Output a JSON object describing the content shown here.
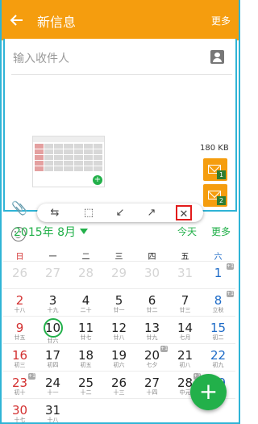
{
  "appbar": {
    "title": "新信息",
    "more": "更多"
  },
  "compose": {
    "recipient_placeholder": "输入收件人",
    "attachment_size": "180 KB",
    "msg_badges": [
      "1",
      "2"
    ]
  },
  "toolbar": {
    "tools": [
      "rotate",
      "crop",
      "shrink",
      "expand",
      "close"
    ]
  },
  "calendar": {
    "month_title": "2015年 8月",
    "today_label": "今天",
    "more_label": "更多",
    "weekdays": [
      "日",
      "一",
      "二",
      "三",
      "四",
      "五",
      "六"
    ],
    "weeks": [
      [
        {
          "d": "26",
          "l": "",
          "f": true
        },
        {
          "d": "27",
          "l": "",
          "f": true
        },
        {
          "d": "28",
          "l": "",
          "f": true
        },
        {
          "d": "29",
          "l": "",
          "f": true
        },
        {
          "d": "30",
          "l": "",
          "f": true
        },
        {
          "d": "31",
          "l": "",
          "f": true
        },
        {
          "d": "1",
          "l": "",
          "f": false,
          "b": true
        }
      ],
      [
        {
          "d": "2",
          "l": "十八"
        },
        {
          "d": "3",
          "l": "十九"
        },
        {
          "d": "4",
          "l": "二十"
        },
        {
          "d": "5",
          "l": "廿一"
        },
        {
          "d": "6",
          "l": "廿二"
        },
        {
          "d": "7",
          "l": "廿三"
        },
        {
          "d": "8",
          "l": "立秋",
          "b": true
        }
      ],
      [
        {
          "d": "9",
          "l": "廿五"
        },
        {
          "d": "10",
          "l": "廿六",
          "today": true
        },
        {
          "d": "11",
          "l": "廿七"
        },
        {
          "d": "12",
          "l": "廿八"
        },
        {
          "d": "13",
          "l": "廿九"
        },
        {
          "d": "14",
          "l": "七月"
        },
        {
          "d": "15",
          "l": "初二"
        }
      ],
      [
        {
          "d": "16",
          "l": "初三"
        },
        {
          "d": "17",
          "l": "初四"
        },
        {
          "d": "18",
          "l": "初五"
        },
        {
          "d": "19",
          "l": "初六"
        },
        {
          "d": "20",
          "l": "七夕",
          "b": true
        },
        {
          "d": "21",
          "l": "初八"
        },
        {
          "d": "22",
          "l": "初九"
        }
      ],
      [
        {
          "d": "23",
          "l": "初十",
          "b": true
        },
        {
          "d": "24",
          "l": "十一"
        },
        {
          "d": "25",
          "l": "十二"
        },
        {
          "d": "26",
          "l": "十三"
        },
        {
          "d": "27",
          "l": "十四"
        },
        {
          "d": "28",
          "l": "中元",
          "b": true
        },
        {
          "d": "29",
          "l": ""
        }
      ],
      [
        {
          "d": "30",
          "l": "十七"
        },
        {
          "d": "31",
          "l": "十八"
        },
        {
          "d": "",
          "l": ""
        },
        {
          "d": "",
          "l": ""
        },
        {
          "d": "",
          "l": ""
        },
        {
          "d": "",
          "l": ""
        },
        {
          "d": "",
          "l": ""
        }
      ]
    ]
  },
  "fab_label": "+",
  "colors": {
    "accent_orange": "#f59d0e",
    "accent_green": "#22b04a",
    "sunday_red": "#d32f2f",
    "saturday_blue": "#1e6bc7"
  }
}
